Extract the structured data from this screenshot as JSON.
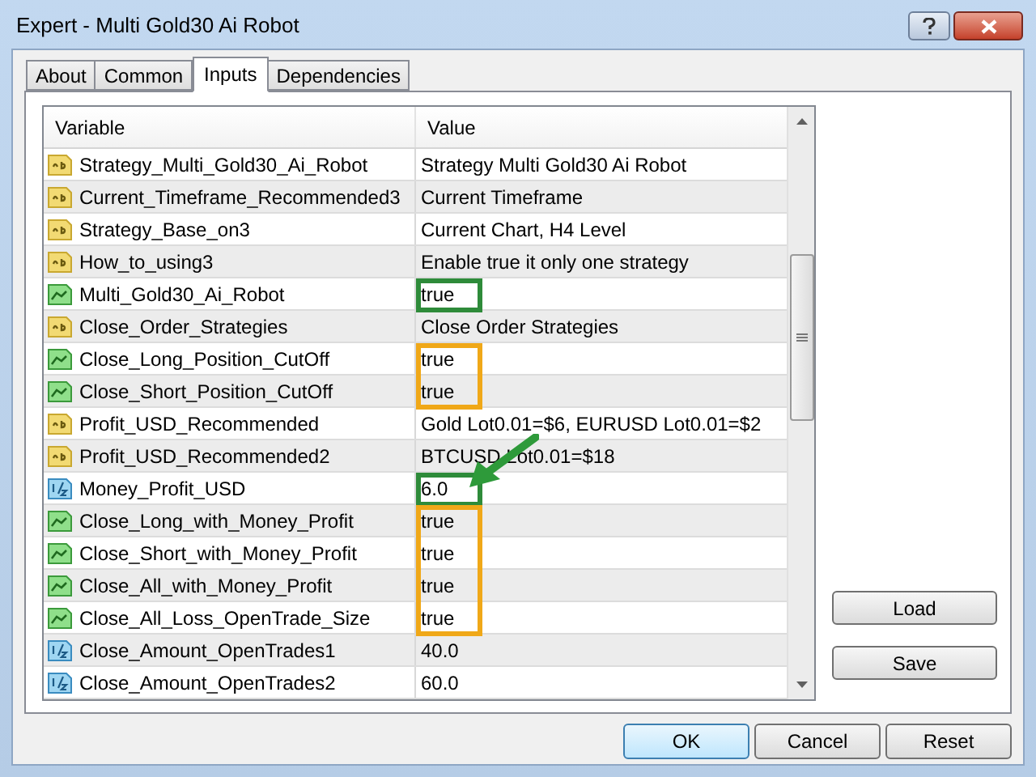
{
  "window": {
    "title": "Expert - Multi Gold30 Ai Robot"
  },
  "tabs": [
    {
      "label": "About",
      "selected": false
    },
    {
      "label": "Common",
      "selected": false
    },
    {
      "label": "Inputs",
      "selected": true
    },
    {
      "label": "Dependencies",
      "selected": false
    }
  ],
  "table": {
    "columns": [
      "Variable",
      "Value"
    ],
    "rows": [
      {
        "kind": "string",
        "variable": "Strategy_Multi_Gold30_Ai_Robot",
        "value": "Strategy Multi Gold30 Ai Robot"
      },
      {
        "kind": "string",
        "variable": "Current_Timeframe_Recommended3",
        "value": "Current Timeframe"
      },
      {
        "kind": "string",
        "variable": "Strategy_Base_on3",
        "value": "Current Chart, H4 Level"
      },
      {
        "kind": "string",
        "variable": "How_to_using3",
        "value": "Enable true it only one strategy"
      },
      {
        "kind": "bool",
        "variable": "Multi_Gold30_Ai_Robot",
        "value": "true",
        "color": "#2e8b3a"
      },
      {
        "kind": "string",
        "variable": "Close_Order_Strategies",
        "value": "Close Order Strategies"
      },
      {
        "kind": "bool",
        "variable": "Close_Long_Position_CutOff",
        "value": "true",
        "color": "#f0a818"
      },
      {
        "kind": "bool",
        "variable": "Close_Short_Position_CutOff",
        "value": "true",
        "color": "#f0a818"
      },
      {
        "kind": "string",
        "variable": "Profit_USD_Recommended",
        "value": "Gold Lot0.01=$6, EURUSD Lot0.01=$2"
      },
      {
        "kind": "string",
        "variable": "Profit_USD_Recommended2",
        "value": "BTCUSD Lot0.01=$18"
      },
      {
        "kind": "double",
        "variable": "Money_Profit_USD",
        "value": "6.0",
        "color": "#2e8b3a",
        "pointer": true
      },
      {
        "kind": "bool",
        "variable": "Close_Long_with_Money_Profit",
        "value": "true",
        "color": "#f0a818"
      },
      {
        "kind": "bool",
        "variable": "Close_Short_with_Money_Profit",
        "value": "true",
        "color": "#f0a818"
      },
      {
        "kind": "bool",
        "variable": "Close_All_with_Money_Profit",
        "value": "true",
        "color": "#f0a818"
      },
      {
        "kind": "bool",
        "variable": "Close_All_Loss_OpenTrade_Size",
        "value": "true",
        "color": "#f0a818"
      },
      {
        "kind": "double",
        "variable": "Close_Amount_OpenTrades1",
        "value": "40.0"
      },
      {
        "kind": "double",
        "variable": "Close_Amount_OpenTrades2",
        "value": "60.0"
      }
    ]
  },
  "side_buttons": [
    "Load",
    "Save"
  ],
  "buttons": [
    {
      "label": "OK",
      "default": true
    },
    {
      "label": "Cancel",
      "default": false
    },
    {
      "label": "Reset",
      "default": false
    }
  ]
}
